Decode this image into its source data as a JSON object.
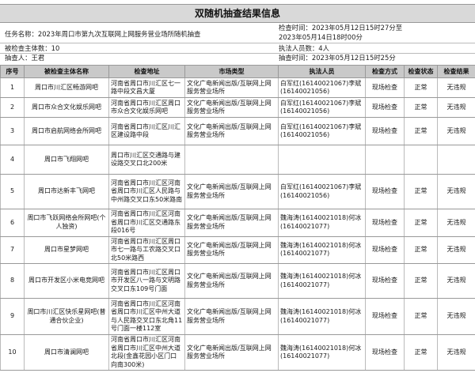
{
  "title": "双随机抽查结果信息",
  "meta": {
    "task_name_label": "任务名称：",
    "task_name": "2023年周口市第九次互联网上网服务营业场所随机抽查",
    "check_time_label": "检查时间：",
    "check_time_1": "2023年05月12日15时27分至",
    "check_time_2": "2023年05月14日18时00分",
    "count_label": "被检查主体数：",
    "count": "10",
    "staff_count_label": "执法人员数：",
    "staff_count": "4人",
    "recorder_label": "抽查人：",
    "recorder": "王君",
    "draw_time_label": "抽查时间：",
    "draw_time": "2023年05月12日15时25分"
  },
  "columns": [
    "序号",
    "被检查主体名称",
    "检查地址",
    "市场类型",
    "执法人员",
    "检查方式",
    "检查状态",
    "检查结果"
  ],
  "rows": [
    {
      "idx": "1",
      "name": "周口市川汇区畅游网吧",
      "addr": "河南省周口市川汇区七一路中段文昌大厦",
      "type": "文化广电新闻出版/互联网上网服务营业场所",
      "staff": "白军红(16140021067)李斌(16140021056)",
      "method": "现场检查",
      "status": "正常",
      "result": "无违规"
    },
    {
      "idx": "2",
      "name": "周口市众合文化娱乐网吧",
      "addr": "河南省周口市川汇区周口市众合文化娱乐网吧",
      "type": "文化广电新闻出版/互联网上网服务营业场所",
      "staff": "白军红(16140021067)李斌(16140021056)",
      "method": "现场检查",
      "status": "正常",
      "result": "无违规"
    },
    {
      "idx": "3",
      "name": "周口市启航网络会所网吧",
      "addr": "河南省周口市川汇区川汇区建设路中段",
      "type": "文化广电新闻出版/互联网上网服务营业场所",
      "staff": "白军红(16140021067)李斌(16140021056)",
      "method": "现场检查",
      "status": "正常",
      "result": "无违规"
    },
    {
      "idx": "4",
      "name": "周口市飞翔网吧",
      "addr": "周口市川汇区交通路与建设路交叉口北200米",
      "type": "",
      "staff": "",
      "method": "",
      "status": "",
      "result": ""
    },
    {
      "idx": "5",
      "name": "周口市达新丰飞网吧",
      "addr": "河南省周口市川汇区河南省周口市川汇区人民路与中州路交叉口东50米路南",
      "type": "文化广电新闻出版/互联网上网服务营业场所",
      "staff": "白军红(16140021067)李斌(16140021056)",
      "method": "现场检查",
      "status": "正常",
      "result": "无违规"
    },
    {
      "idx": "6",
      "name": "周口市飞跃网络会所网吧(个人独资)",
      "addr": "河南省周口市川汇区河南省周口市川汇区交通路东段016号",
      "type": "文化广电新闻出版/互联网上网服务营业场所",
      "staff": "魏海涛(16140021018)何冰(16140021077)",
      "method": "现场检查",
      "status": "正常",
      "result": "无违规"
    },
    {
      "idx": "7",
      "name": "周口市星梦网吧",
      "addr": "河南省周口市川汇区周口市七一路与工农路交叉口北50米路西",
      "type": "文化广电新闻出版/互联网上网服务营业场所",
      "staff": "魏海涛(16140021018)何冰(16140021077)",
      "method": "现场检查",
      "status": "正常",
      "result": "无违规"
    },
    {
      "idx": "8",
      "name": "周口市开发区小米电竞网吧",
      "addr": "河南省周口市川汇区周口市开发区八一路与文明路交叉口东109号门面",
      "type": "文化广电新闻出版/互联网上网服务营业场所",
      "staff": "魏海涛(16140021018)何冰(16140021077)",
      "method": "现场检查",
      "status": "正常",
      "result": "无违规"
    },
    {
      "idx": "9",
      "name": "周口市川汇区快乐星网吧(普通合伙企业)",
      "addr": "河南省周口市川汇区河南省周口市川汇区中州大道与人民路交叉口东北角11号门面一楼112室",
      "type": "文化广电新闻出版/互联网上网服务营业场所",
      "staff": "魏海涛(16140021018)何冰(16140021077)",
      "method": "现场检查",
      "status": "正常",
      "result": "无违规"
    },
    {
      "idx": "10",
      "name": "周口市清澜网吧",
      "addr": "河南省周口市川汇区河南省周口市川汇区中州大道北段(金鑫花园小区门口向南300米)",
      "type": "文化广电新闻出版/互联网上网服务营业场所",
      "staff": "魏海涛(16140021018)何冰(16140021077)",
      "method": "现场检查",
      "status": "正常",
      "result": "无违规"
    }
  ]
}
